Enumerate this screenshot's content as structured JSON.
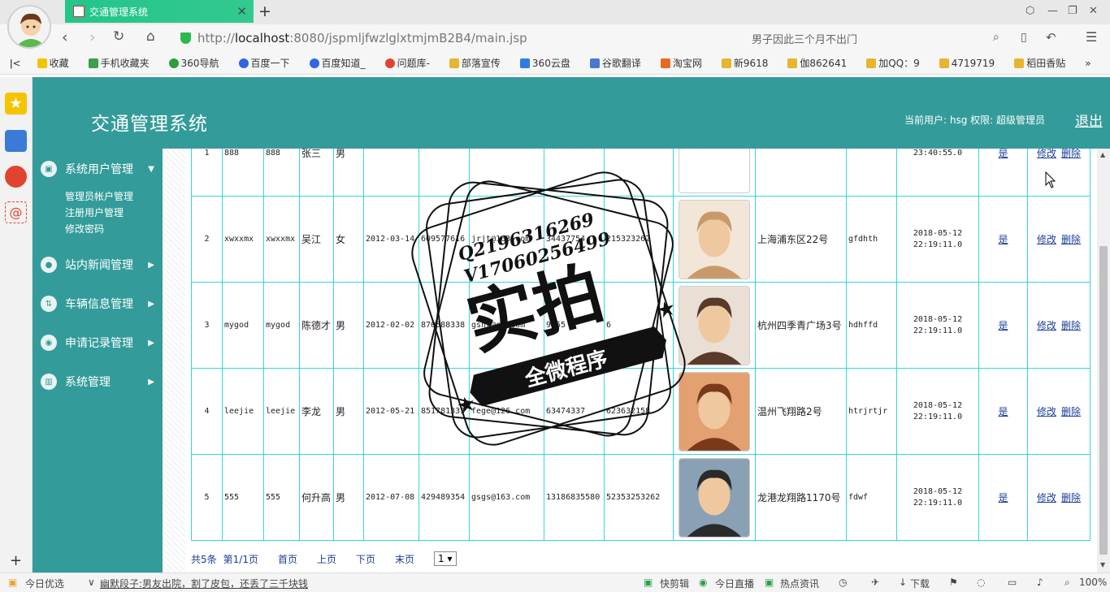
{
  "browser": {
    "tab_title": "交通管理系统",
    "url_prefix": "http://",
    "url_host": "localhost",
    "url_rest": ":8080/jspmljfwzlglxtmjmB2B4/main.jsp",
    "search_placeholder": "男子因此三个月不出门",
    "bookmarks": [
      "收藏",
      "手机收藏夹",
      "360导航",
      "百度一下",
      "百度知道_",
      "问题库-",
      "部落宣传",
      "360云盘",
      "谷歌翻译",
      "淘宝网",
      "新9618",
      "伽862641",
      "加QQ：9",
      "4719719",
      "稻田香贴"
    ]
  },
  "app": {
    "title": "交通管理系统",
    "user_info": "当前用户: hsg  权限: 超级管理员",
    "logout": "退出"
  },
  "sidebar": {
    "menu": [
      {
        "label": "系统用户管理",
        "icon": "monitor-icon"
      },
      {
        "label": "站内新闻管理",
        "icon": "user-icon"
      },
      {
        "label": "车辆信息管理",
        "icon": "vehicle-icon"
      },
      {
        "label": "申请记录管理",
        "icon": "app-icon"
      },
      {
        "label": "系统管理",
        "icon": "chart-icon"
      }
    ],
    "submenu": [
      "管理员帐户管理",
      "注册用户管理",
      "修改密码"
    ]
  },
  "table": {
    "rows": [
      {
        "no": "1",
        "user": "888",
        "pwd": "888",
        "name": "张三",
        "sex": "男",
        "birth": "",
        "id": "",
        "email": "",
        "phone": "",
        "tel": "",
        "addr": "",
        "note": "",
        "time": "23:40:55.0",
        "flag": "是",
        "edit": "修改",
        "del": "删除"
      },
      {
        "no": "2",
        "user": "xwxxmx",
        "pwd": "xwxxmx",
        "name": "吴江",
        "sex": "女",
        "birth": "2012-03-14",
        "id": "609577616",
        "email": "jrjt@163.com",
        "phone": "34437754",
        "tel": "215323262",
        "addr": "上海浦东区22号",
        "note": "gfdhth",
        "time": "2018-05-12 22:19:11.0",
        "flag": "是",
        "edit": "修改",
        "del": "删除"
      },
      {
        "no": "3",
        "user": "mygod",
        "pwd": "mygod",
        "name": "陈德才",
        "sex": "男",
        "birth": "2012-02-02",
        "id": "870588338",
        "email": "gshr@sh.com",
        "phone": "9655",
        "tel": "6",
        "addr": "杭州四季青广场3号",
        "note": "hdhffd",
        "time": "2018-05-12 22:19:11.0",
        "flag": "是",
        "edit": "修改",
        "del": "删除"
      },
      {
        "no": "4",
        "user": "leejie",
        "pwd": "leejie",
        "name": "李龙",
        "sex": "男",
        "birth": "2012-05-21",
        "id": "851781333",
        "email": "fege@126.com",
        "phone": "63474337",
        "tel": "623632158",
        "addr": "温州飞翔路2号",
        "note": "htrjrtjr",
        "time": "2018-05-12 22:19:11.0",
        "flag": "是",
        "edit": "修改",
        "del": "删除"
      },
      {
        "no": "5",
        "user": "555",
        "pwd": "555",
        "name": "何升高",
        "sex": "男",
        "birth": "2012-07-08",
        "id": "429489354",
        "email": "gsgs@163.com",
        "phone": "13186835580",
        "tel": "52353253262",
        "addr": "龙港龙翔路1170号",
        "note": "fdwf",
        "time": "2018-05-12 22:19:11.0",
        "flag": "是",
        "edit": "修改",
        "del": "删除"
      }
    ]
  },
  "pager": {
    "total": "共5条",
    "page": "第1/1页",
    "first": "首页",
    "prev": "上页",
    "next": "下页",
    "last": "末页",
    "select": "1 ▾"
  },
  "watermark": {
    "line1": "Q2196316269",
    "line2": "V17060256499",
    "big": "实拍",
    "banner": "全微程序"
  },
  "statusbar": {
    "left": "今日优选",
    "news": "幽默段子:男友出院，割了皮包，还丢了三千块钱",
    "kuaijian": "快剪辑",
    "live": "今日直播",
    "hot": "热点资讯",
    "download": "下载",
    "zoom": "100%"
  }
}
